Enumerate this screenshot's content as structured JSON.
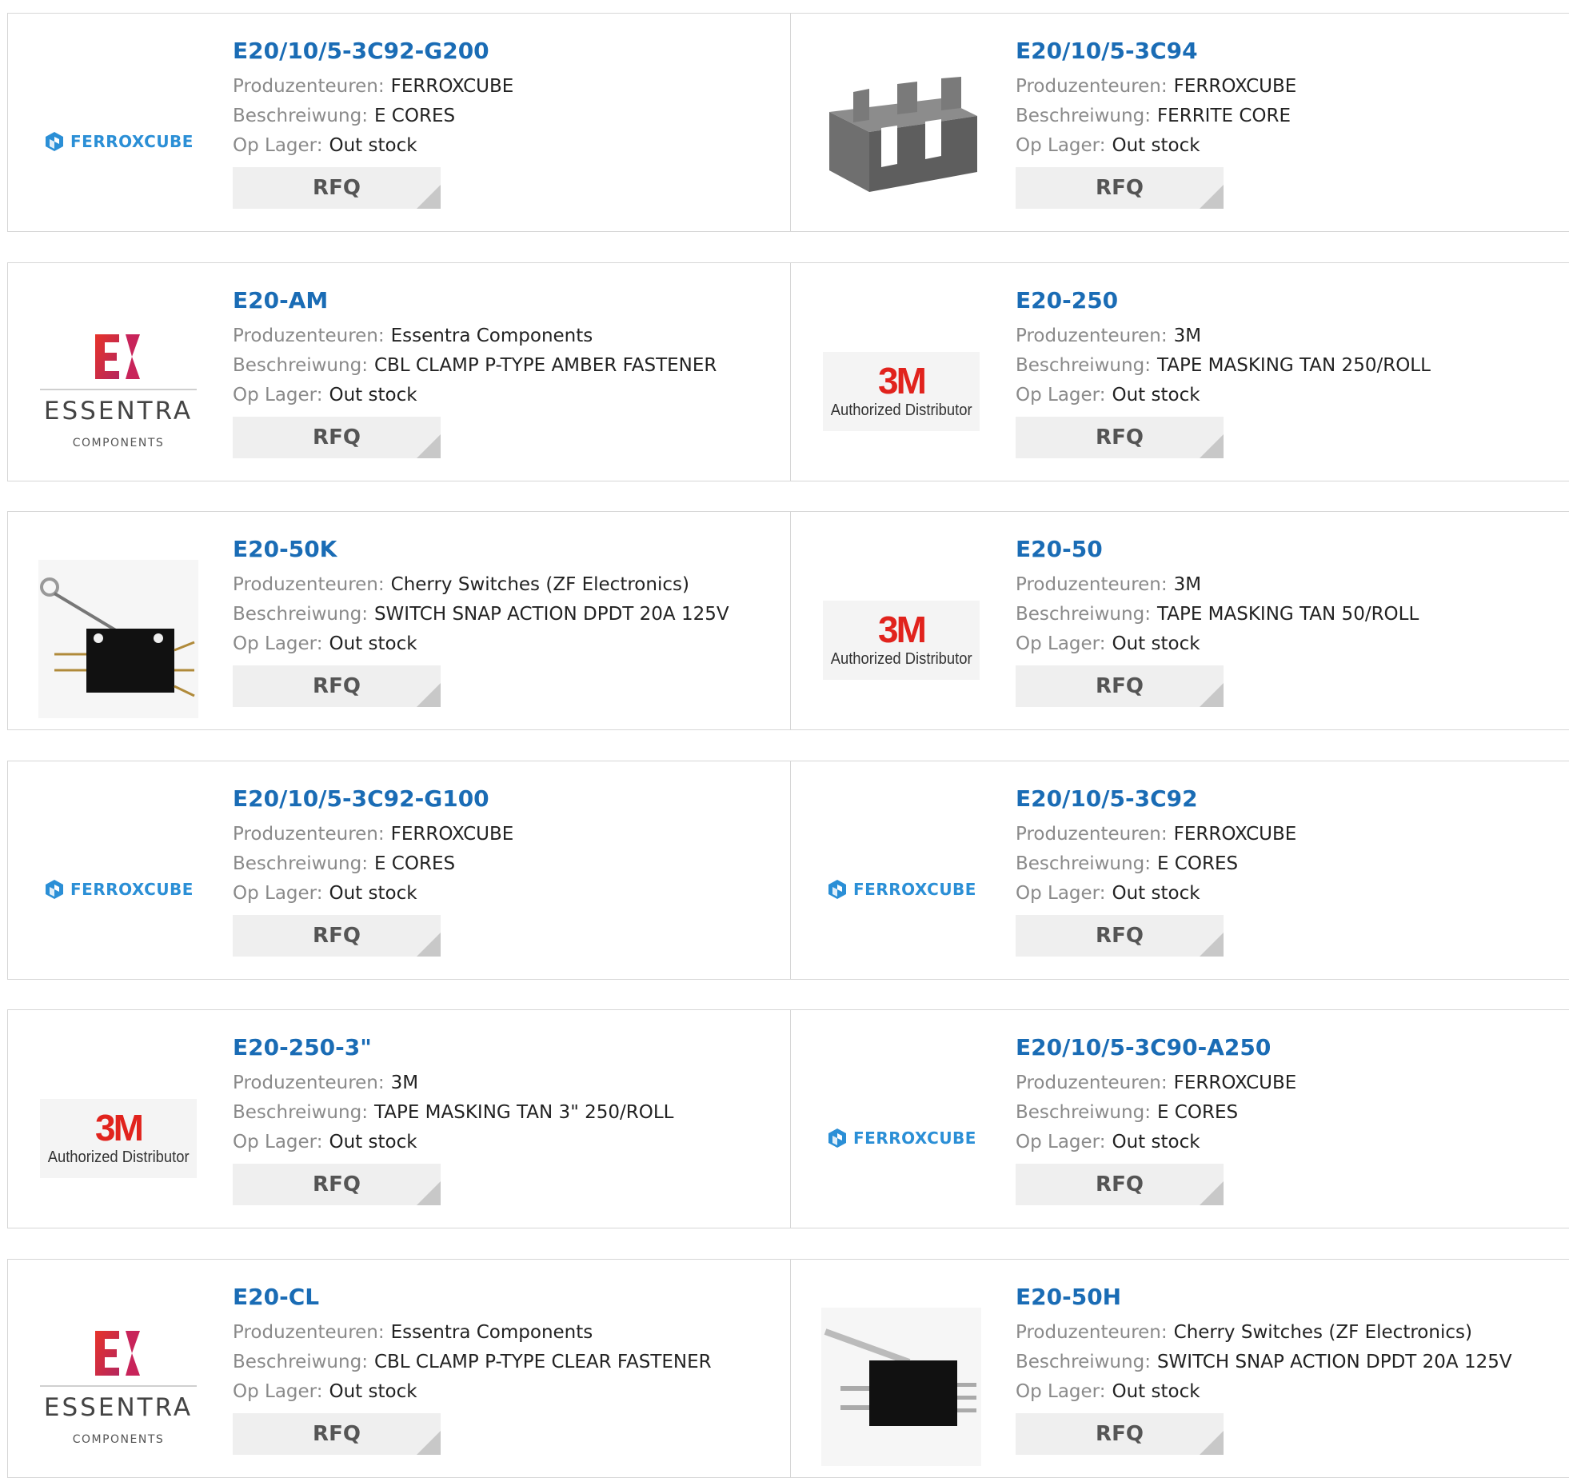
{
  "labels": {
    "manufacturer": "Produzenteuren:",
    "description": "Beschreiwung:",
    "stock": "Op Lager:",
    "rfq": "RFQ"
  },
  "logo_text": {
    "ferroxcube": "FERROXCUBE",
    "three_m": "3M",
    "authorized": "Authorized Distributor",
    "essentra_mark": "E",
    "essentra": "ESSENTRA",
    "components": "COMPONENTS"
  },
  "rows": [
    [
      {
        "part": "E20/10/5-3C92-G200",
        "manufacturer": "FERROXCUBE",
        "description": "E CORES",
        "stock": "Out stock",
        "logo": "ferroxcube"
      },
      {
        "part": "E20/10/5-3C94",
        "manufacturer": "FERROXCUBE",
        "description": "FERRITE CORE",
        "stock": "Out stock",
        "logo": "ferrite-core-photo"
      }
    ],
    [
      {
        "part": "E20-AM",
        "manufacturer": "Essentra Components",
        "description": "CBL CLAMP P-TYPE AMBER FASTENER",
        "stock": "Out stock",
        "logo": "essentra"
      },
      {
        "part": "E20-250",
        "manufacturer": "3M",
        "description": "TAPE MASKING TAN 250/ROLL",
        "stock": "Out stock",
        "logo": "3m"
      }
    ],
    [
      {
        "part": "E20-50K",
        "manufacturer": "Cherry Switches (ZF Electronics)",
        "description": "SWITCH SNAP ACTION DPDT 20A 125V",
        "stock": "Out stock",
        "logo": "switch-roller-photo"
      },
      {
        "part": "E20-50",
        "manufacturer": "3M",
        "description": "TAPE MASKING TAN 50/ROLL",
        "stock": "Out stock",
        "logo": "3m"
      }
    ],
    [
      {
        "part": "E20/10/5-3C92-G100",
        "manufacturer": "FERROXCUBE",
        "description": "E CORES",
        "stock": "Out stock",
        "logo": "ferroxcube"
      },
      {
        "part": "E20/10/5-3C92",
        "manufacturer": "FERROXCUBE",
        "description": "E CORES",
        "stock": "Out stock",
        "logo": "ferroxcube"
      }
    ],
    [
      {
        "part": "E20-250-3\"",
        "manufacturer": "3M",
        "description": "TAPE MASKING TAN 3\" 250/ROLL",
        "stock": "Out stock",
        "logo": "3m"
      },
      {
        "part": "E20/10/5-3C90-A250",
        "manufacturer": "FERROXCUBE",
        "description": "E CORES",
        "stock": "Out stock",
        "logo": "ferroxcube"
      }
    ],
    [
      {
        "part": "E20-CL",
        "manufacturer": "Essentra Components",
        "description": "CBL CLAMP P-TYPE CLEAR FASTENER",
        "stock": "Out stock",
        "logo": "essentra"
      },
      {
        "part": "E20-50H",
        "manufacturer": "Cherry Switches (ZF Electronics)",
        "description": "SWITCH SNAP ACTION DPDT 20A 125V",
        "stock": "Out stock",
        "logo": "switch-lever-photo"
      }
    ]
  ]
}
